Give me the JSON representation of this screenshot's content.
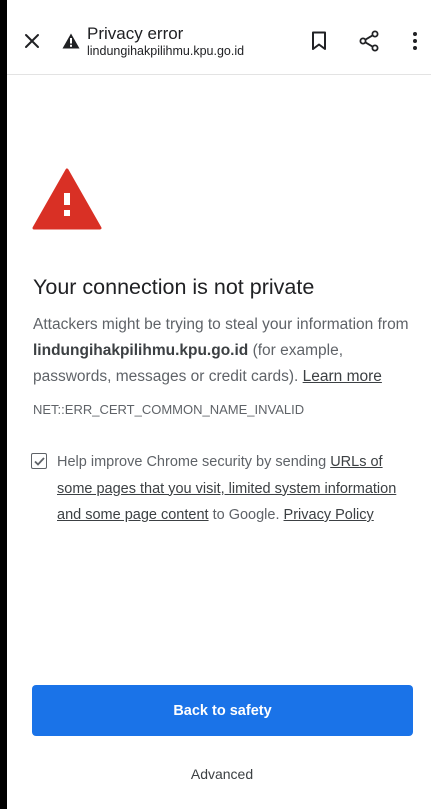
{
  "toolbar": {
    "title": "Privacy error",
    "url": "lindungihakpilihmu.kpu.go.id",
    "icons": {
      "close": "close-icon",
      "warning": "warning-icon",
      "bookmark": "bookmark-icon",
      "share": "share-icon",
      "menu": "more-vert-icon"
    }
  },
  "interstitial": {
    "heading": "Your connection is not private",
    "body_prefix": "Attackers might be trying to steal your information from ",
    "domain": "lindungihakpilihmu.kpu.go.id",
    "body_suffix": " (for example, passwords, messages or credit cards). ",
    "learn_more": "Learn more",
    "error_code": "NET::ERR_CERT_COMMON_NAME_INVALID",
    "optin": {
      "checked": true,
      "prefix": "Help improve Chrome security by sending ",
      "link": "URLs of some pages that you visit, limited system information and some page content",
      "suffix": " to Google. ",
      "privacy_link": "Privacy Policy"
    },
    "primary_button": "Back to safety",
    "advanced_button": "Advanced"
  },
  "colors": {
    "accent": "#1a73e8",
    "warning_red": "#d93025",
    "text_primary": "#202124",
    "text_secondary": "#5f6368"
  }
}
